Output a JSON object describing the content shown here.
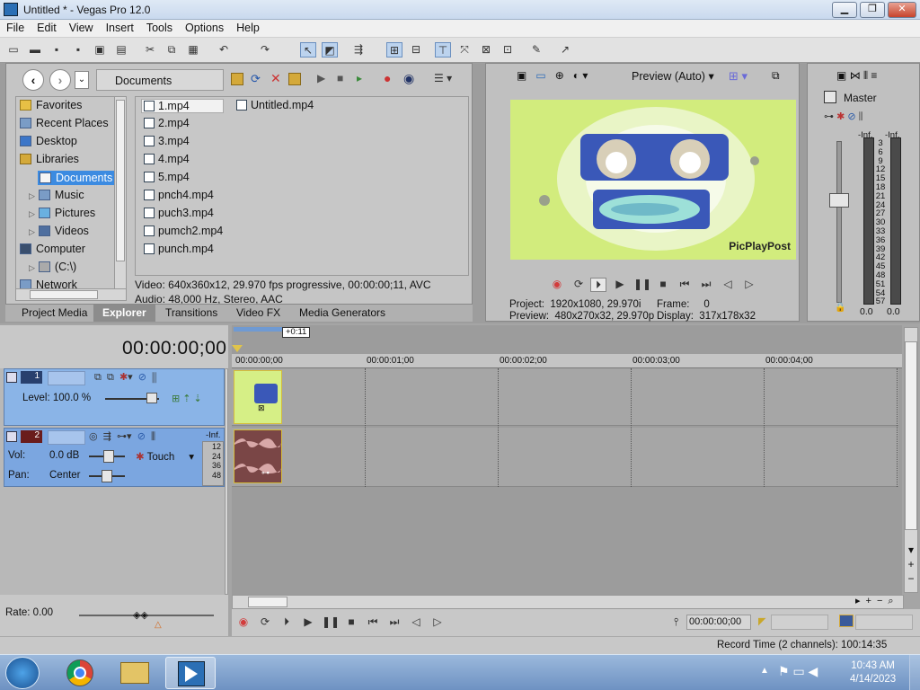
{
  "window": {
    "title": "Untitled * - Vegas Pro 12.0",
    "minimize": "▁",
    "maximize": "❐",
    "close": "✕"
  },
  "menu": [
    "File",
    "Edit",
    "View",
    "Insert",
    "Tools",
    "Options",
    "Help"
  ],
  "explorer": {
    "address": "Documents",
    "tree": [
      {
        "label": "Favorites"
      },
      {
        "label": "Recent Places"
      },
      {
        "label": "Desktop"
      },
      {
        "label": "Libraries"
      },
      {
        "label": "Documents",
        "selected": true
      },
      {
        "label": "Music"
      },
      {
        "label": "Pictures"
      },
      {
        "label": "Videos"
      },
      {
        "label": "Computer"
      },
      {
        "label": "(C:\\)"
      },
      {
        "label": "Network"
      }
    ],
    "files": [
      "1.mp4",
      "2.mp4",
      "3.mp4",
      "4.mp4",
      "5.mp4",
      "pnch4.mp4",
      "puch3.mp4",
      "pumch2.mp4",
      "punch.mp4"
    ],
    "files_col2": [
      "Untitled.mp4"
    ],
    "info_video": "Video: 640x360x12, 29.970 fps progressive, 00:00:00;11, AVC",
    "info_audio": "Audio: 48,000 Hz, Stereo, AAC",
    "tabs": [
      "Project Media",
      "Explorer",
      "Transitions",
      "Video FX",
      "Media Generators"
    ],
    "active_tab": "Explorer"
  },
  "preview": {
    "mode": "Preview (Auto)",
    "watermark": "PicPlayPost",
    "project_label": "Project:",
    "project_value": "1920x1080, 29.970i",
    "preview_label": "Preview:",
    "preview_value": "480x270x32, 29.970p",
    "frame_label": "Frame:",
    "frame_value": "0",
    "display_label": "Display:",
    "display_value": "317x178x32"
  },
  "mixer": {
    "title": "Master",
    "inf_left": "-Inf.",
    "inf_right": "-Inf.",
    "scale": [
      "3",
      "6",
      "9",
      "12",
      "15",
      "18",
      "21",
      "24",
      "27",
      "30",
      "33",
      "36",
      "39",
      "42",
      "45",
      "48",
      "51",
      "54",
      "57"
    ],
    "value_left": "0.0",
    "value_right": "0.0"
  },
  "timeline": {
    "timecode": "00:00:00;00",
    "duration_badge": "+0:11",
    "ruler": [
      "00:00:00;00",
      "00:00:01;00",
      "00:00:02;00",
      "00:00:03;00",
      "00:00:04;00"
    ],
    "video_track": {
      "number": "1",
      "level_label": "Level: 100.0 %"
    },
    "audio_track": {
      "number": "2",
      "vol_label": "Vol:",
      "vol_value": "0.0 dB",
      "pan_label": "Pan:",
      "pan_value": "Center",
      "automation": "Touch",
      "meter_inf": "-Inf.",
      "meter_scale": [
        "12",
        "24",
        "36",
        "48"
      ]
    },
    "rate": "Rate: 0.00",
    "cursor_time": "00:00:00;00"
  },
  "status": {
    "record_time": "Record Time (2 channels): 100:14:35"
  },
  "taskbar": {
    "time": "10:43 AM",
    "date": "4/14/2023"
  },
  "colors": {
    "accent": "#3c8be1",
    "video_track": "#8ab4e7",
    "record_red": "#d23c3c",
    "preview_bg": "#d2ec7d"
  }
}
